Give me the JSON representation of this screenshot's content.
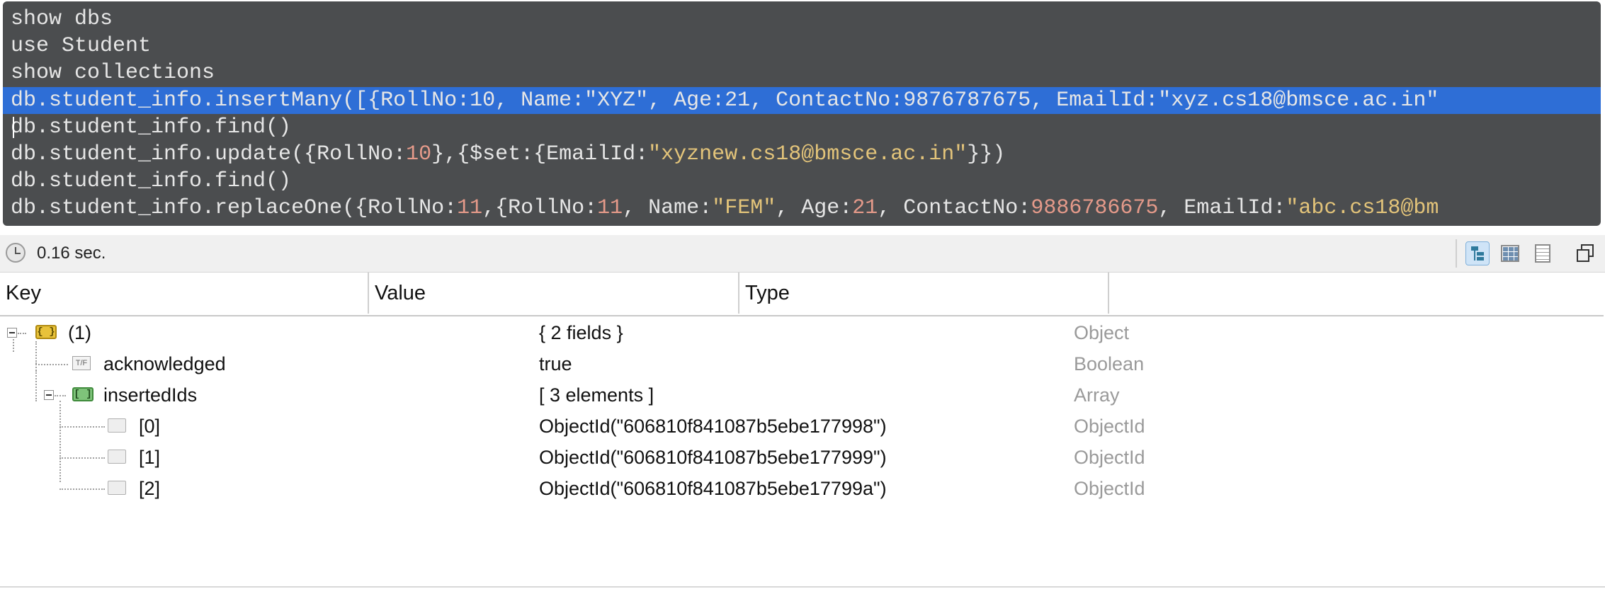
{
  "editor": {
    "lines": [
      [
        {
          "t": "show dbs",
          "c": "def"
        }
      ],
      [
        {
          "t": "use Student",
          "c": "def"
        }
      ],
      [
        {
          "t": "show collections",
          "c": "def"
        }
      ],
      [
        {
          "t": "db.student_info.insertMany([{RollNo:10, Name:\"XYZ\", Age:21, ContactNo:9876787675, EmailId:\"xyz.cs18@bmsce.ac.in\"",
          "c": "def"
        }
      ],
      [
        {
          "t": "db.student_info.find()",
          "c": "def"
        }
      ],
      [
        {
          "t": "db.student_info.update({RollNo:",
          "c": "def"
        },
        {
          "t": "10",
          "c": "num"
        },
        {
          "t": "},{$set:{EmailId:",
          "c": "def"
        },
        {
          "t": "\"xyznew.cs18@bmsce.ac.in\"",
          "c": "str"
        },
        {
          "t": "}})",
          "c": "def"
        }
      ],
      [
        {
          "t": "db.student_info.find()",
          "c": "def"
        }
      ],
      [
        {
          "t": "db.student_info.replaceOne({RollNo:",
          "c": "def"
        },
        {
          "t": "11",
          "c": "num"
        },
        {
          "t": ",{RollNo:",
          "c": "def"
        },
        {
          "t": "11",
          "c": "num"
        },
        {
          "t": ", Name:",
          "c": "def"
        },
        {
          "t": "\"FEM\"",
          "c": "str"
        },
        {
          "t": ", Age:",
          "c": "def"
        },
        {
          "t": "21",
          "c": "num"
        },
        {
          "t": ", ContactNo:",
          "c": "def"
        },
        {
          "t": "9886786675",
          "c": "num"
        },
        {
          "t": ", EmailId:",
          "c": "def"
        },
        {
          "t": "\"abc.cs18@bm",
          "c": "str"
        }
      ]
    ],
    "selected_line": 3,
    "cursor_line": 4
  },
  "toolbar": {
    "exec_time": "0.16 sec."
  },
  "table": {
    "columns": {
      "key": "Key",
      "value": "Value",
      "type": "Type"
    },
    "rows": [
      {
        "key": "(1)",
        "value": "{ 2 fields }",
        "type": "Object"
      },
      {
        "key": "acknowledged",
        "value": "true",
        "type": "Boolean"
      },
      {
        "key": "insertedIds",
        "value": "[ 3 elements ]",
        "type": "Array"
      },
      {
        "key": "[0]",
        "value": "ObjectId(\"606810f841087b5ebe177998\")",
        "type": "ObjectId"
      },
      {
        "key": "[1]",
        "value": "ObjectId(\"606810f841087b5ebe177999\")",
        "type": "ObjectId"
      },
      {
        "key": "[2]",
        "value": "ObjectId(\"606810f841087b5ebe17799a\")",
        "type": "ObjectId"
      }
    ]
  },
  "icons": {
    "tree_view": "tree-view-icon",
    "table_view": "table-view-icon",
    "text_view": "text-view-icon",
    "maximize": "maximize-icon",
    "clock": "clock-icon"
  },
  "colors": {
    "editor_bg": "#4b4d4f",
    "selection": "#2e6ed6",
    "string": "#e3c47a",
    "number": "#e59a8a"
  }
}
